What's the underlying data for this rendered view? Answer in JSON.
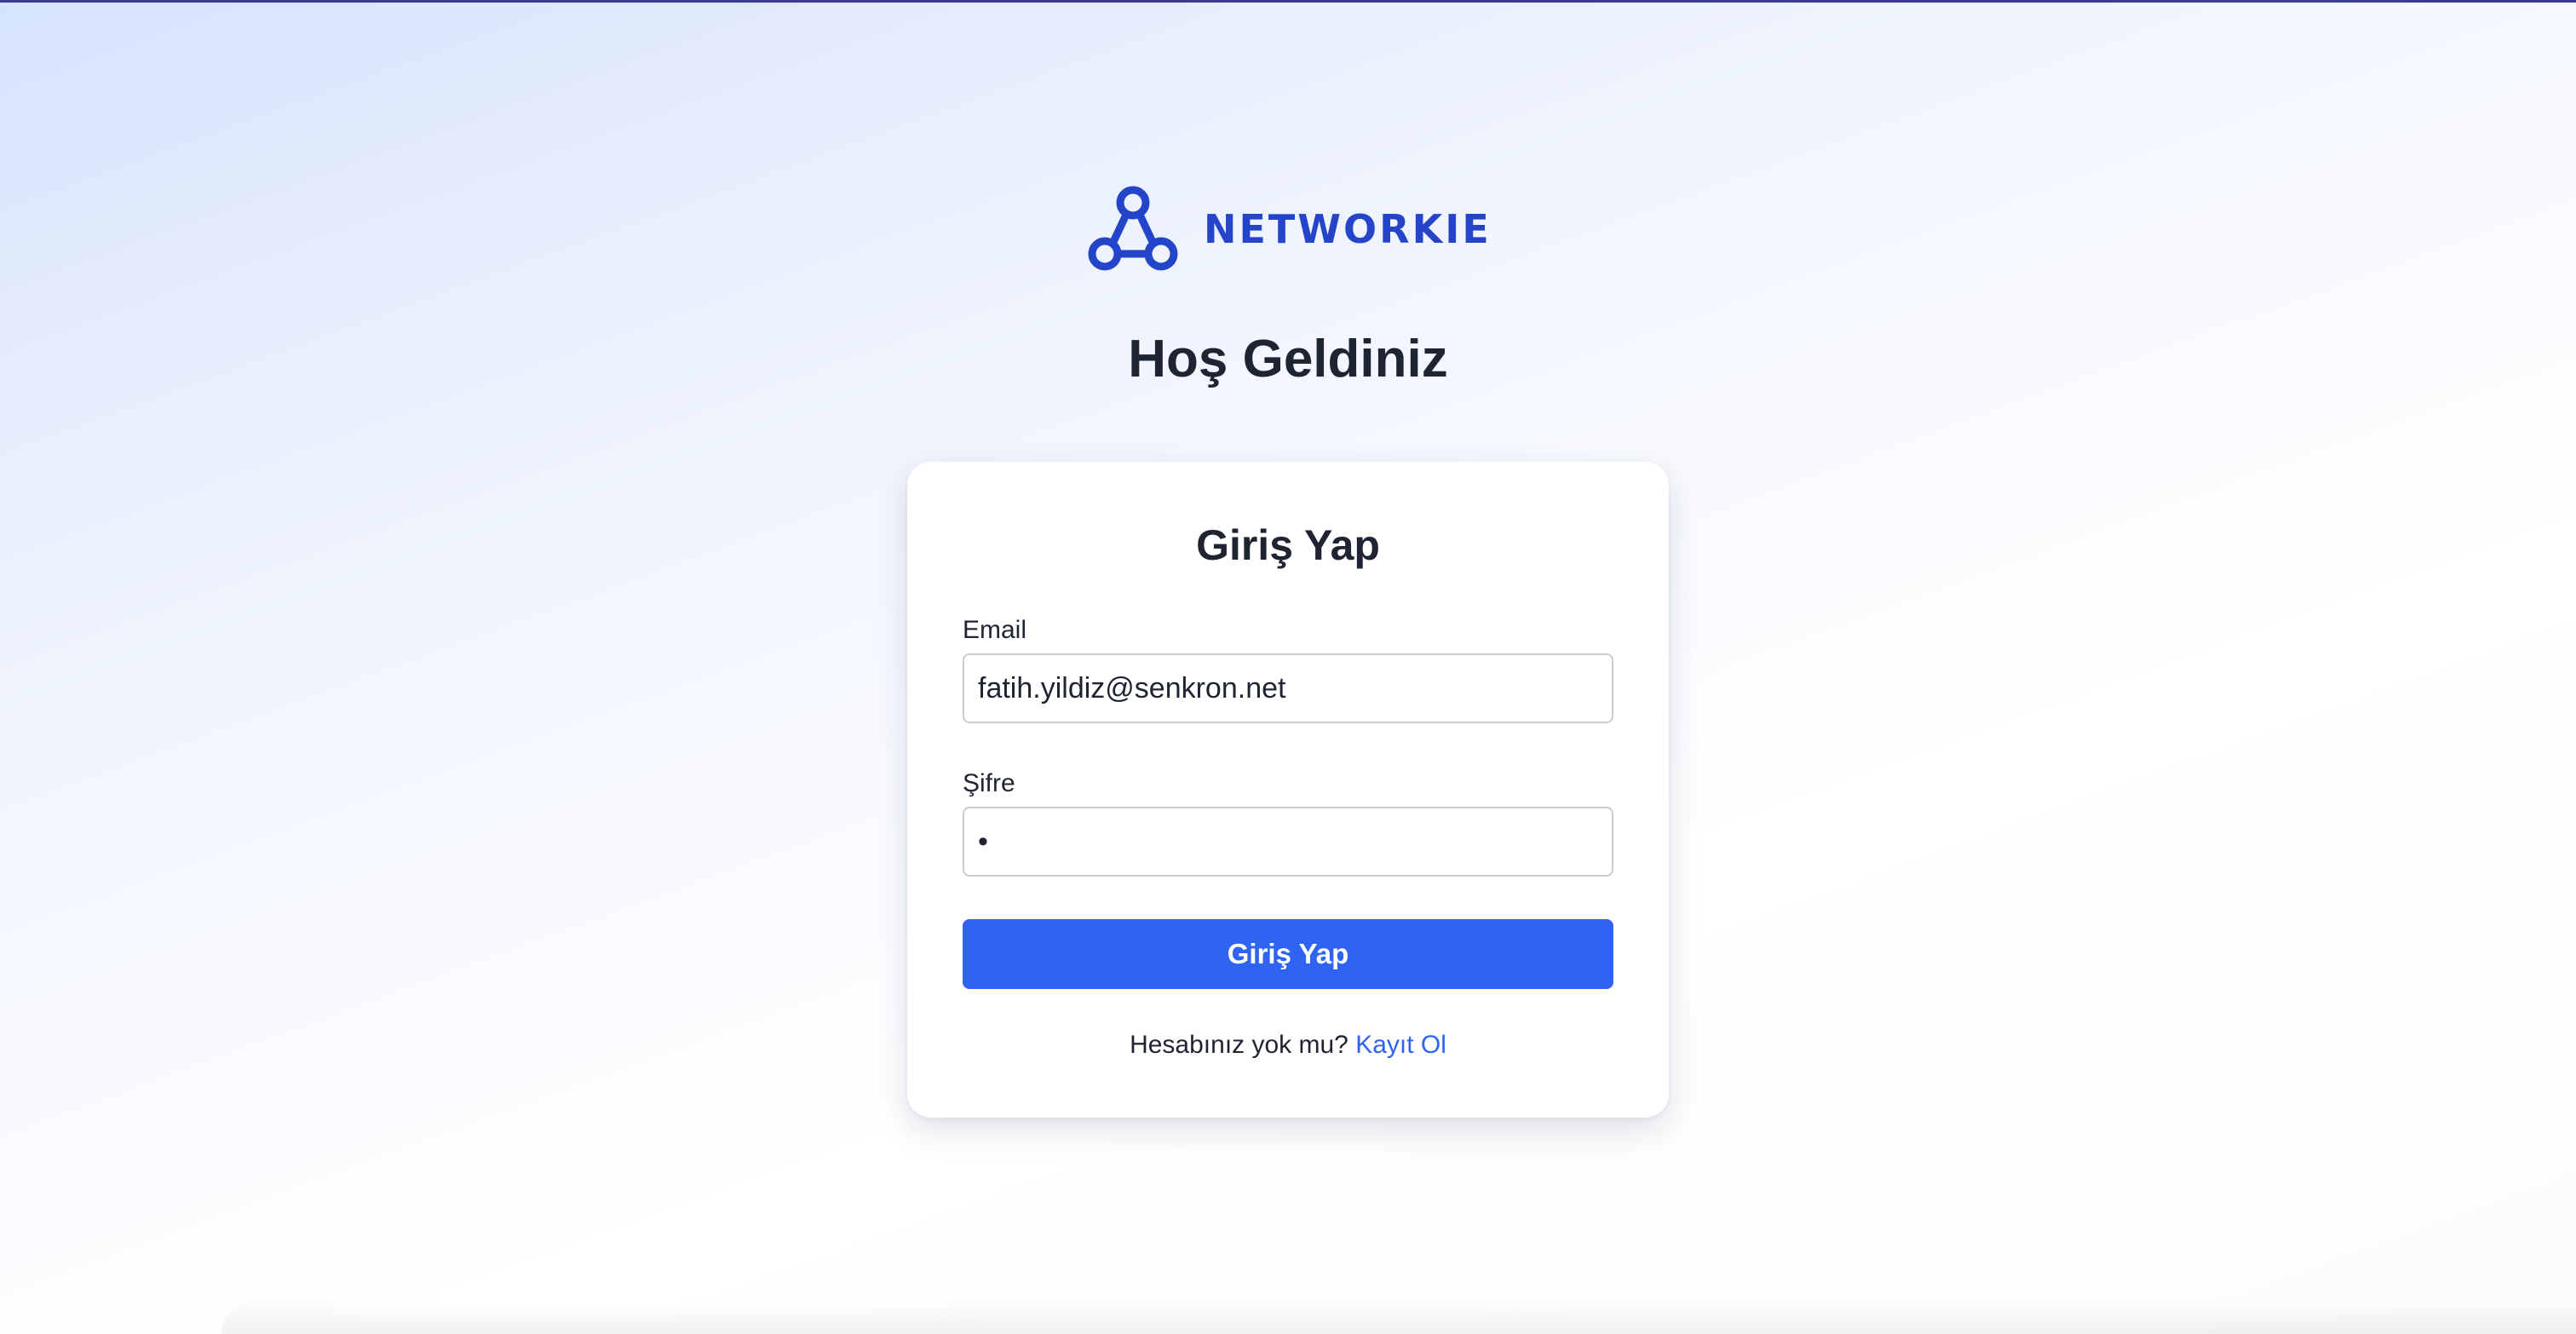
{
  "brand": {
    "name": "NETWORKIE",
    "logo_icon": "network-nodes-icon",
    "color": "#2445c9"
  },
  "page": {
    "welcome_title": "Hoş Geldiniz"
  },
  "login_form": {
    "title": "Giriş Yap",
    "email_label": "Email",
    "email_value": "fatih.yildiz@senkron.net",
    "password_label": "Şifre",
    "password_value": "•",
    "submit_label": "Giriş Yap",
    "no_account_text": "Hesabınız yok mu?",
    "signup_link": "Kayıt Ol"
  },
  "colors": {
    "accent": "#2f63f1",
    "text": "#1f2433"
  }
}
